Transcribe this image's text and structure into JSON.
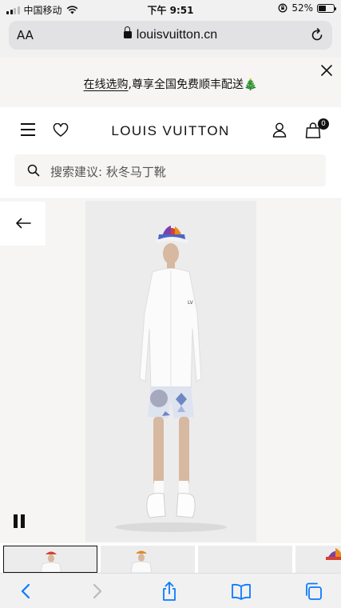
{
  "status_bar": {
    "carrier": "中国移动",
    "time": "下午 9:51",
    "battery_percent": "52%",
    "battery_level": 0.52
  },
  "browser": {
    "text_size_label": "AA",
    "url": "louisvuitton.cn"
  },
  "promo": {
    "link_text": "在线选购",
    "text": ",尊享全国免费顺丰配送",
    "emoji": "🎄"
  },
  "header": {
    "brand": "LOUIS VUITTON",
    "bag_count": "0"
  },
  "search": {
    "placeholder": "搜索建议: 秋冬马丁靴"
  },
  "product": {
    "shirt_print": "LV"
  },
  "icons": {
    "menu": "hamburger-menu-icon",
    "wishlist": "heart-icon",
    "account": "user-icon",
    "bag": "shopping-bag-icon",
    "search": "search-icon",
    "back": "arrow-left-icon",
    "pause": "pause-icon"
  },
  "colors": {
    "accent": "#111111",
    "banner_bg": "#f6f5f3",
    "toolbar_blue": "#0a7aff"
  }
}
